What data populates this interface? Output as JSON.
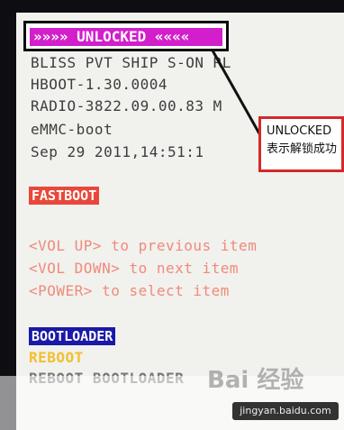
{
  "bootloader": {
    "banner": "»»»» UNLOCKED ««««",
    "lines": [
      "BLISS PVT SHIP S-ON RL",
      "HBOOT-1.30.0004",
      "RADIO-3822.09.00.83 M",
      "eMMC-boot",
      "Sep 29 2011,14:51:1"
    ],
    "fastboot_label": "FASTBOOT",
    "menu": [
      "<VOL UP> to previous item",
      "<VOL DOWN> to next item",
      "<POWER> to select item"
    ],
    "bootloader_label": "BOOTLOADER",
    "reboot_label": "REBOOT",
    "reboot_bootloader_label": "REBOOT BOOTLOADER"
  },
  "callout": {
    "title": "UNLOCKED",
    "text": "表示解锁成功"
  },
  "watermark": {
    "logo": "Bai 经验",
    "url": "jingyan.baidu.com"
  },
  "colors": {
    "banner": "#d21ecb",
    "fastboot": "#e8483a",
    "menu_text": "#f08a7a",
    "bootloader_bar": "#1a1aa8",
    "reboot_text": "#f2c030",
    "callout_border": "#d62828"
  }
}
